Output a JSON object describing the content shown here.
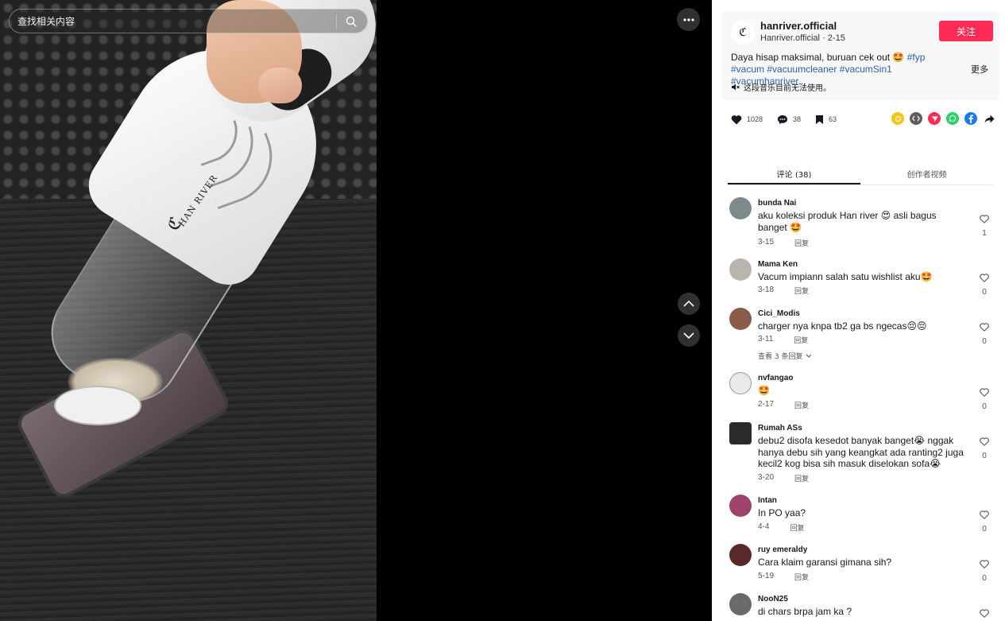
{
  "search": {
    "placeholder": "查找相关内容"
  },
  "video": {
    "logo_text": "HAN RIVER",
    "more_icon": "more-horizontal-icon",
    "nav": {
      "up_icon": "chevron-up-icon",
      "down_icon": "chevron-down-icon"
    }
  },
  "author": {
    "username": "hanriver.official",
    "nickname": "Hanriver.official",
    "date": "2-15",
    "follow_label": "关注"
  },
  "description": {
    "text": "Daya hisap maksimal, buruan cek out 🤩",
    "tags": [
      "#fyp",
      "#vacum",
      "#vacuumcleaner",
      "#vacumSin1",
      "#vacumhanriver..."
    ],
    "more_label": "更多"
  },
  "music": {
    "text": "这段音乐目前无法使用。"
  },
  "stats": {
    "likes": "1028",
    "comments": "38",
    "favorites": "63"
  },
  "share_icons": [
    {
      "name": "coin-share-icon",
      "color": "#f5c518"
    },
    {
      "name": "embed-code-icon",
      "color": "#5d5d5d"
    },
    {
      "name": "paper-plane-icon",
      "color": "#fe2c55"
    },
    {
      "name": "whatsapp-icon",
      "color": "#25d366"
    },
    {
      "name": "facebook-icon",
      "color": "#1877f2"
    },
    {
      "name": "forward-arrow-icon",
      "color": "#161823"
    }
  ],
  "tabs": [
    {
      "label": "评论 (38)",
      "active": true
    },
    {
      "label": "创作者视频",
      "active": false
    }
  ],
  "comments": [
    {
      "user": "bunda Nai",
      "text": "aku koleksi produk Han river 😍 asli bagus banget 🤩",
      "date": "3-15",
      "reply": "回复",
      "likes": "1",
      "avatar_color": "#7c8a8c"
    },
    {
      "user": "Mama Ken",
      "text": "Vacum impiann salah satu wishlist aku🤩",
      "date": "3-18",
      "reply": "回复",
      "likes": "0",
      "avatar_color": "#b9b5ae"
    },
    {
      "user": "Cici_Modis",
      "text": "charger nya knpa tb2 ga bs ngecas😔😔",
      "date": "3-11",
      "reply": "回复",
      "likes": "0",
      "avatar_color": "#8a5a4a",
      "more_replies": "查看 3 条回复"
    },
    {
      "user": "nvfangao",
      "text": "🤩",
      "date": "2-17",
      "reply": "回复",
      "likes": "0",
      "avatar_color": "#e9e9e9"
    },
    {
      "user": "Rumah ASs",
      "text": "debu2 disofa kesedot banyak banget😭 nggak hanya debu sih yang keangkat ada ranting2 juga kecil2 kog bisa sih masuk diselokan sofa😭",
      "date": "3-20",
      "reply": "回复",
      "likes": "0",
      "avatar_color": "#2a2a2a"
    },
    {
      "user": "Intan",
      "text": "In PO yaa?",
      "date": "4-4",
      "reply": "回复",
      "likes": "0",
      "avatar_color": "#a0436a"
    },
    {
      "user": "ruy emeraldy",
      "text": "Cara klaim garansi gimana sih?",
      "date": "5-19",
      "reply": "回复",
      "likes": "0",
      "avatar_color": "#5a2a2a"
    },
    {
      "user": "NooN25",
      "text": "di chars brpa jam ka ?",
      "date": "",
      "reply": "",
      "likes": "",
      "avatar_color": "#6a6a6a"
    }
  ]
}
